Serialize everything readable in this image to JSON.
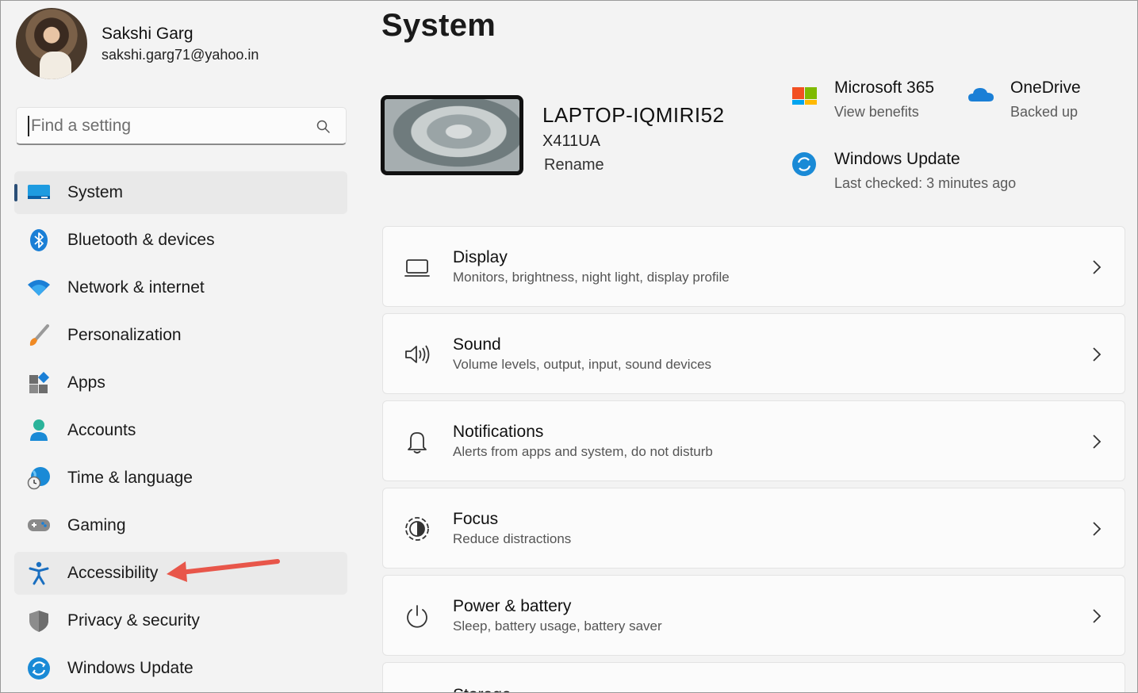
{
  "profile": {
    "name": "Sakshi Garg",
    "email": "sakshi.garg71@yahoo.in"
  },
  "search": {
    "placeholder": "Find a setting"
  },
  "nav": {
    "items": [
      {
        "label": "System"
      },
      {
        "label": "Bluetooth & devices"
      },
      {
        "label": "Network & internet"
      },
      {
        "label": "Personalization"
      },
      {
        "label": "Apps"
      },
      {
        "label": "Accounts"
      },
      {
        "label": "Time & language"
      },
      {
        "label": "Gaming"
      },
      {
        "label": "Accessibility"
      },
      {
        "label": "Privacy & security"
      },
      {
        "label": "Windows Update"
      }
    ]
  },
  "page": {
    "title": "System"
  },
  "device": {
    "name": "LAPTOP-IQMIRI52",
    "model": "X411UA",
    "rename": "Rename"
  },
  "quick": {
    "m365": {
      "title": "Microsoft 365",
      "sub": "View benefits"
    },
    "onedrive": {
      "title": "OneDrive",
      "sub": "Backed up"
    },
    "update": {
      "title": "Windows Update",
      "sub": "Last checked: 3 minutes ago"
    }
  },
  "cards": [
    {
      "title": "Display",
      "sub": "Monitors, brightness, night light, display profile"
    },
    {
      "title": "Sound",
      "sub": "Volume levels, output, input, sound devices"
    },
    {
      "title": "Notifications",
      "sub": "Alerts from apps and system, do not disturb"
    },
    {
      "title": "Focus",
      "sub": "Reduce distractions"
    },
    {
      "title": "Power & battery",
      "sub": "Sleep, battery usage, battery saver"
    },
    {
      "title": "Storage",
      "sub": ""
    }
  ],
  "colors": {
    "accent": "#0067c0",
    "arrow": "#e8564a",
    "active_indicator": "#2b4f77"
  }
}
